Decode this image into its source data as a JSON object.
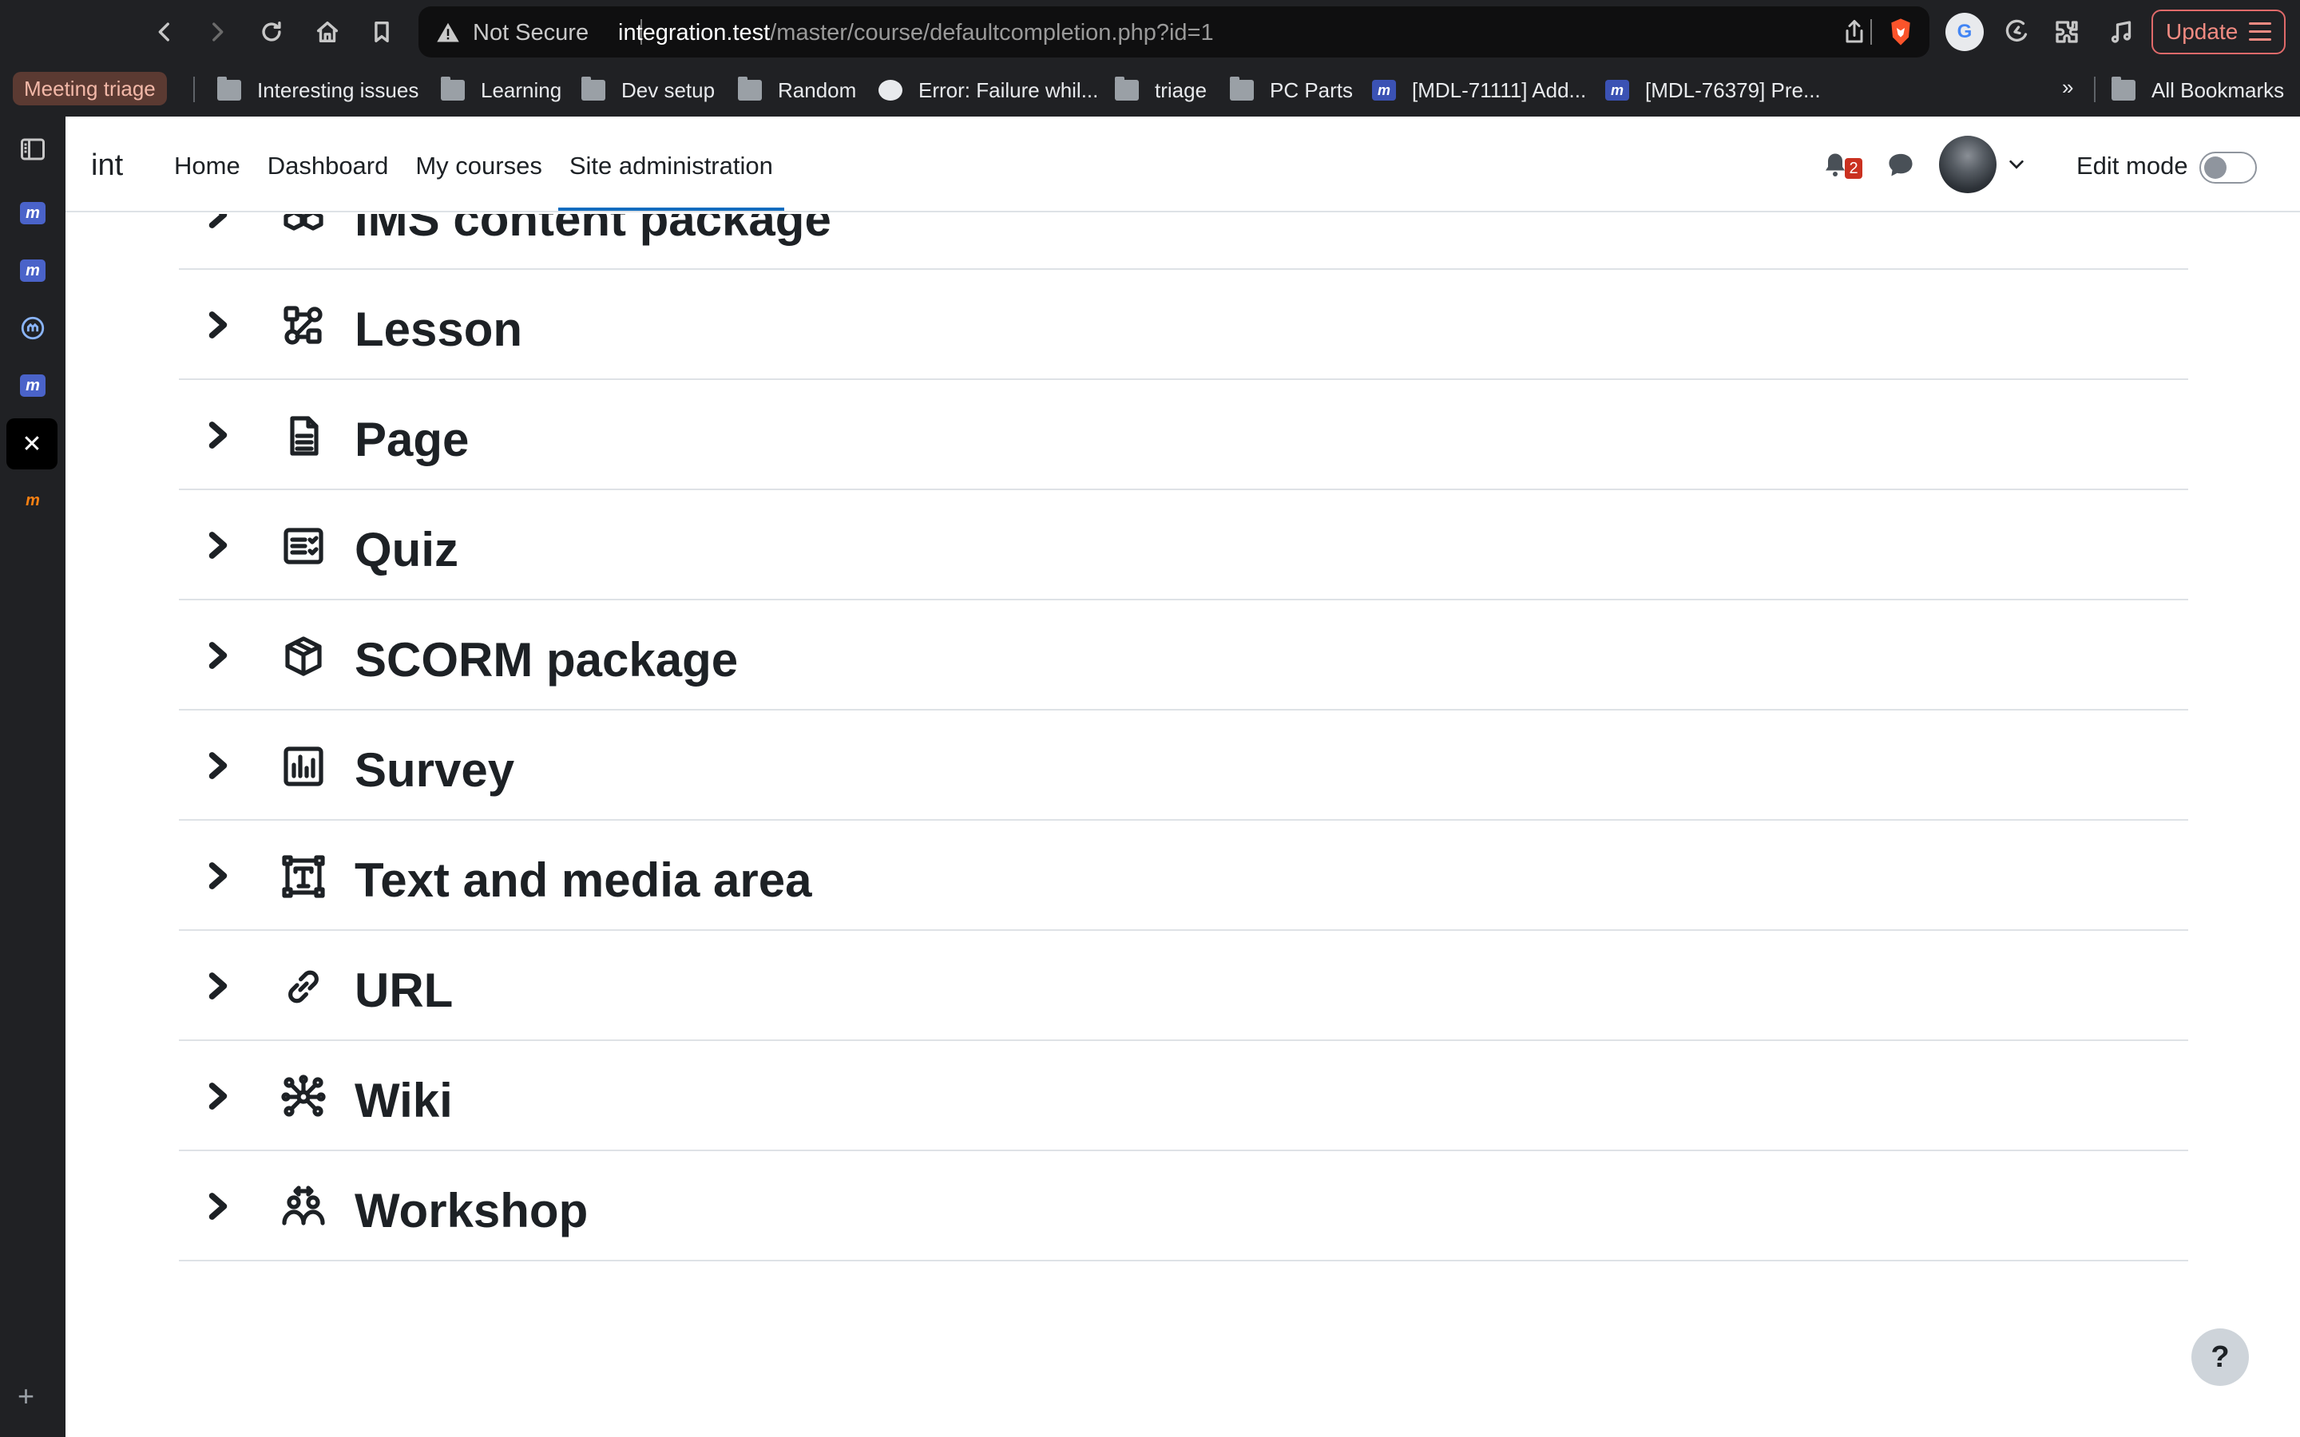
{
  "browser": {
    "security_label": "Not Secure",
    "url_host": "integration.test",
    "url_path": "/master/course/defaultcompletion.php?id=1",
    "update_label": "Update",
    "translate_label": "G"
  },
  "bookmarks": {
    "group": "Meeting triage",
    "items": [
      "Interesting issues",
      "Learning",
      "Dev setup",
      "Random",
      "Error: Failure whil...",
      "triage",
      "PC Parts",
      "[MDL-71111] Add...",
      "[MDL-76379] Pre..."
    ],
    "overflow": "»",
    "all_bookmarks": "All Bookmarks"
  },
  "sidebar": {
    "close_label": "✕",
    "add_label": "+",
    "moodle_glyph": "m"
  },
  "navbar": {
    "brand": "int",
    "items": [
      "Home",
      "Dashboard",
      "My courses",
      "Site administration"
    ],
    "notification_count": "2",
    "edit_mode_label": "Edit mode"
  },
  "modules": [
    {
      "title": "IMS content package",
      "icon": "cubes-icon"
    },
    {
      "title": "Lesson",
      "icon": "lesson-icon"
    },
    {
      "title": "Page",
      "icon": "page-icon"
    },
    {
      "title": "Quiz",
      "icon": "quiz-icon"
    },
    {
      "title": "SCORM package",
      "icon": "box-icon"
    },
    {
      "title": "Survey",
      "icon": "chart-icon"
    },
    {
      "title": "Text and media area",
      "icon": "text-box-icon"
    },
    {
      "title": "URL",
      "icon": "link-icon"
    },
    {
      "title": "Wiki",
      "icon": "network-icon"
    },
    {
      "title": "Workshop",
      "icon": "people-icon"
    }
  ],
  "help": {
    "label": "?"
  }
}
